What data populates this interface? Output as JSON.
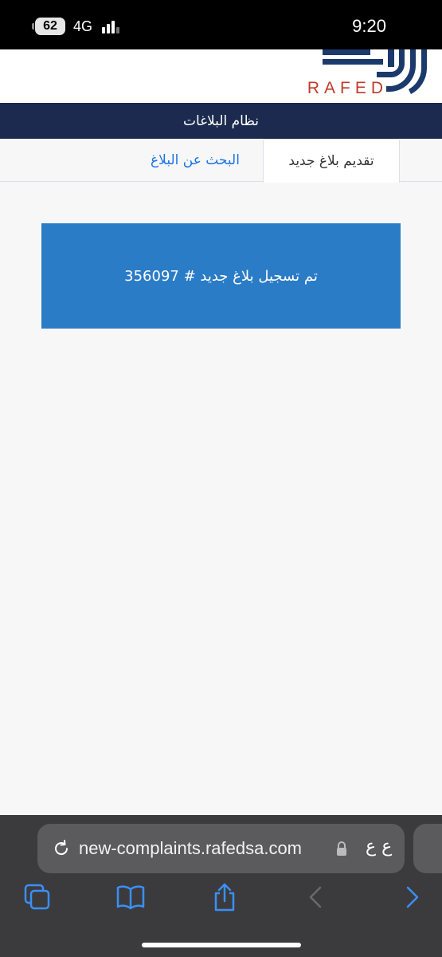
{
  "status_bar": {
    "battery": "62",
    "network": "4G",
    "time": "9:20"
  },
  "header": {
    "logo_text": "RAFED",
    "title": "نظام البلاغات"
  },
  "tabs": [
    {
      "label": "تقديم بلاغ جديد",
      "active": true
    },
    {
      "label": "البحث عن البلاغ",
      "active": false
    }
  ],
  "message": {
    "text": "تم تسجيل بلاغ جديد # 356097"
  },
  "browser": {
    "url": "new-complaints.rafedsa.com",
    "text_size_label": "ع ع",
    "toolbar": [
      "tabs-icon",
      "bookmarks-icon",
      "share-icon",
      "back-icon",
      "forward-icon"
    ]
  },
  "colors": {
    "title_bar": "#1b2a4e",
    "message_bg": "#2b7cc6",
    "tab_link": "#1a73e8",
    "logo_accent": "#c0392b",
    "safari_blue": "#3b8ff5"
  }
}
